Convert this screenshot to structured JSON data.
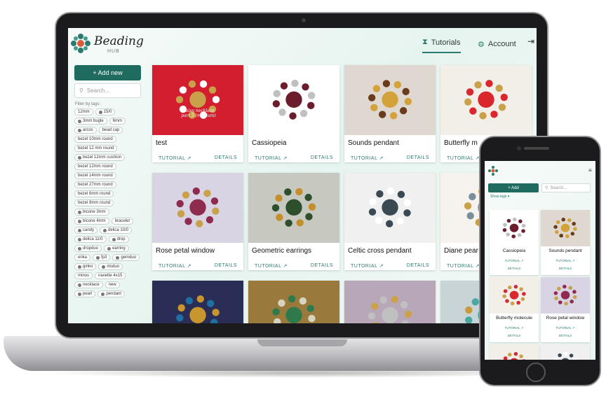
{
  "brand": {
    "name": "Beading",
    "sub": "HUB",
    "accent": "#1f6b5f"
  },
  "nav": {
    "tutorials": "Tutorials",
    "account": "Account"
  },
  "sidebar": {
    "add_label": "+ Add new",
    "search_placeholder": "Search...",
    "filter_label": "Filter by tags:",
    "tags": [
      "12mm",
      "15/0",
      "3mm bugle",
      "6mm",
      "arcos",
      "bead cap",
      "bezel 10mm round",
      "bezel 12 mm round",
      "bezel 12mm cushion",
      "bezel 12mm round",
      "bezel 14mm round",
      "bezel 27mm round",
      "bezel 6mm round",
      "bezel 8mm round",
      "bicone 3mm",
      "bicone 4mm",
      "bracelet",
      "candy",
      "delica 10/0",
      "delica 11/0",
      "drop",
      "dropduo",
      "earring",
      "erika",
      "fp3",
      "gemduo",
      "ginko",
      "irisduo",
      "minos",
      "navette 4x15",
      "necklace",
      "new",
      "pearl",
      "pendant"
    ]
  },
  "cards": [
    {
      "title": "test",
      "tutorial": "TUTORIAL",
      "details": "DETAILS",
      "caption": "Daisy necklace part 3 (medium)"
    },
    {
      "title": "Cassiopeia",
      "tutorial": "TUTORIAL",
      "details": "DETAILS"
    },
    {
      "title": "Sounds pendant",
      "tutorial": "TUTORIAL",
      "details": "DETAILS"
    },
    {
      "title": "Butterfly m",
      "tutorial": "TUTORIAL",
      "details": "DETAILS"
    },
    {
      "title": "Rose petal window",
      "tutorial": "TUTORIAL",
      "details": "DETAILS"
    },
    {
      "title": "Geometric earrings",
      "tutorial": "TUTORIAL",
      "details": "DETAILS"
    },
    {
      "title": "Celtic cross pendant",
      "tutorial": "TUTORIAL",
      "details": "DETAILS"
    },
    {
      "title": "Diane pear",
      "tutorial": "TUTORIAL",
      "details": "DETAILS"
    }
  ],
  "phone": {
    "add_label": "+ Add",
    "search_placeholder": "Search...",
    "show_tags": "Show tags ▾",
    "cards": [
      {
        "title": "Cassiopeia",
        "tutorial": "TUTORIAL",
        "details": "DETAILS"
      },
      {
        "title": "Sounds pendant",
        "tutorial": "TUTORIAL",
        "details": "DETAILS"
      },
      {
        "title": "Butterfly molecule",
        "tutorial": "TUTORIAL",
        "details": "DETAILS"
      },
      {
        "title": "Rose petal window",
        "tutorial": "TUTORIAL",
        "details": "DETAILS"
      }
    ]
  }
}
